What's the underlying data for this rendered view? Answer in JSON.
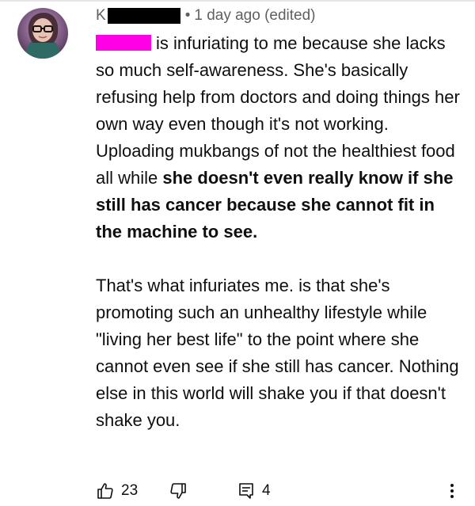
{
  "comment": {
    "author_initial": "K",
    "meta": "1 day ago (edited)",
    "separator": "•",
    "text_part1": "is infuriating to me because she lacks so much self-awareness. She's basically refusing help from doctors and doing things her own way even though it's not working. Uploading mukbangs of not the healthiest food all while ",
    "text_bold": "she doesn't even really know if she still has cancer because she cannot fit in the machine to see.",
    "paragraph2": "That's what infuriates me. is that she's promoting such an unhealthy lifestyle while \"living her best life\" to the point where she cannot even see if she still has cancer. Nothing else in this world will shake you if that doesn't shake you."
  },
  "actions": {
    "like_count": "23",
    "reply_count": "4"
  },
  "icons": {
    "like": "thumbs-up-icon",
    "dislike": "thumbs-down-icon",
    "reply": "reply-icon",
    "more": "more-vert-icon"
  },
  "colors": {
    "redaction_black": "#000000",
    "redaction_pink": "#ff00e6",
    "meta_text": "#606060",
    "body_text": "#0f0f0f"
  }
}
